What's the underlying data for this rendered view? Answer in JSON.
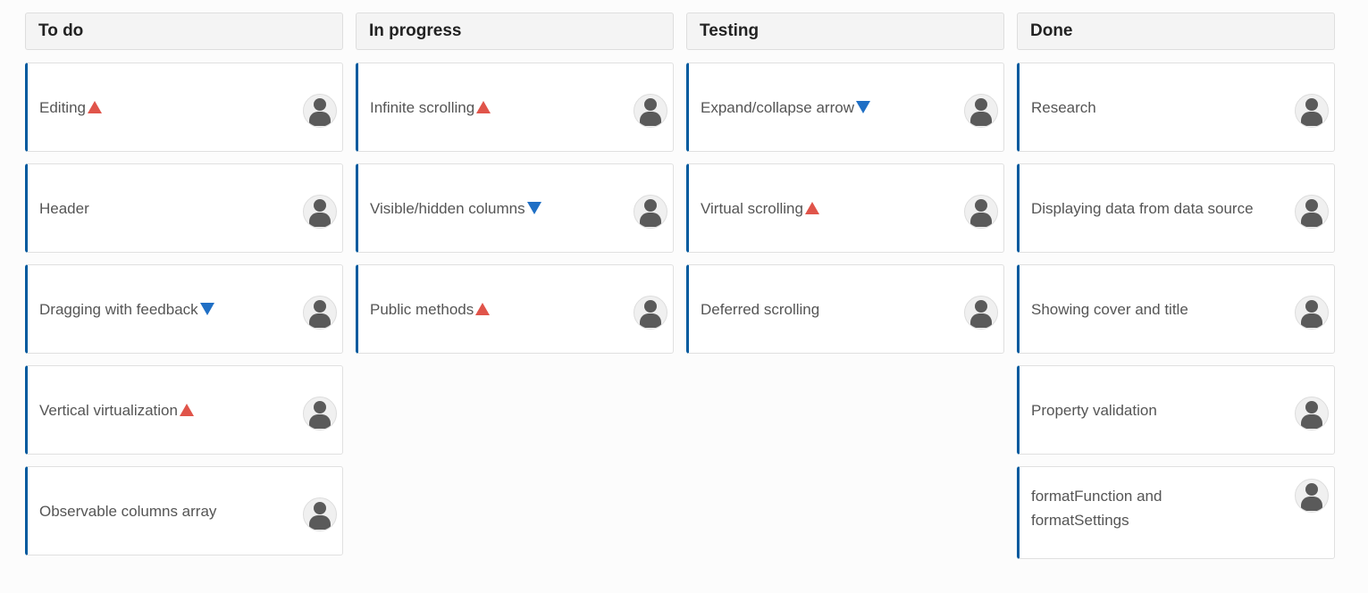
{
  "columns": [
    {
      "title": "To do",
      "cards": [
        {
          "text": "Editing",
          "priority": "high"
        },
        {
          "text": "Header",
          "priority": ""
        },
        {
          "text": "Dragging with feedback",
          "priority": "low"
        },
        {
          "text": "Vertical virtualization",
          "priority": "high"
        },
        {
          "text": "Observable columns array",
          "priority": ""
        }
      ]
    },
    {
      "title": "In progress",
      "cards": [
        {
          "text": "Infinite scrolling",
          "priority": "high"
        },
        {
          "text": "Visible/hidden columns",
          "priority": "low"
        },
        {
          "text": "Public methods",
          "priority": "high"
        }
      ]
    },
    {
      "title": "Testing",
      "cards": [
        {
          "text": "Expand/collapse arrow",
          "priority": "low"
        },
        {
          "text": "Virtual scrolling",
          "priority": "high"
        },
        {
          "text": "Deferred scrolling",
          "priority": ""
        }
      ]
    },
    {
      "title": "Done",
      "cards": [
        {
          "text": "Research",
          "priority": ""
        },
        {
          "text": "Displaying data from data source",
          "priority": ""
        },
        {
          "text": "Showing cover and title",
          "priority": ""
        },
        {
          "text": "Property validation",
          "priority": ""
        },
        {
          "text": "formatFunction and formatSettings",
          "priority": ""
        }
      ]
    }
  ],
  "colors": {
    "accent": "#005a9e",
    "priority_high": "#e0544a",
    "priority_low": "#1f6fc5"
  }
}
